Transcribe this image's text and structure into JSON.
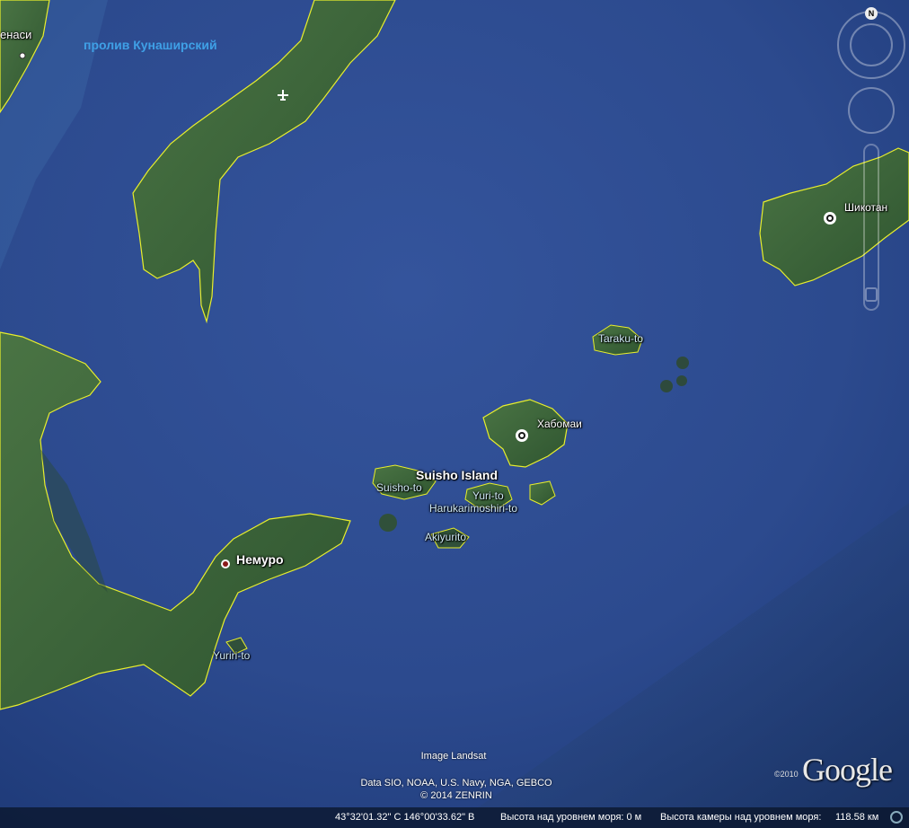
{
  "labels": {
    "top_left_cut": "енаси",
    "strait": "пролив Кунаширский",
    "shikotan": "Шикотан",
    "taraku": "Taraku-to",
    "habomai": "Хабомаи",
    "suisho_island": "Suisho Island",
    "suisho_to": "Suisho-to",
    "yuri_to": "Yuri-to",
    "harukarimoshiri": "Harukarimoshiri-to",
    "akiyurito": "Akiyurito",
    "nemuro": "Немуро",
    "yuriri": "Yuriri-to"
  },
  "attribution": {
    "image": "Image Landsat",
    "data": "Data SIO, NOAA, U.S. Navy, NGA, GEBCO",
    "copyright": "© 2014 ZENRIN"
  },
  "logo": {
    "text": "Google",
    "year": "©2010"
  },
  "navigation": {
    "north": "N"
  },
  "status_bar": {
    "coords": "43°32'01.32\" С  146°00'33.62\" В",
    "elevation": "Высота над уровнем моря: 0 м",
    "eye_alt": "Высота камеры над уровнем моря:",
    "eye_alt_value": "118.58 км"
  },
  "colors": {
    "sea": "#2a4a8c",
    "land": "#3f6a3a",
    "coastline": "#e8ee2c"
  }
}
